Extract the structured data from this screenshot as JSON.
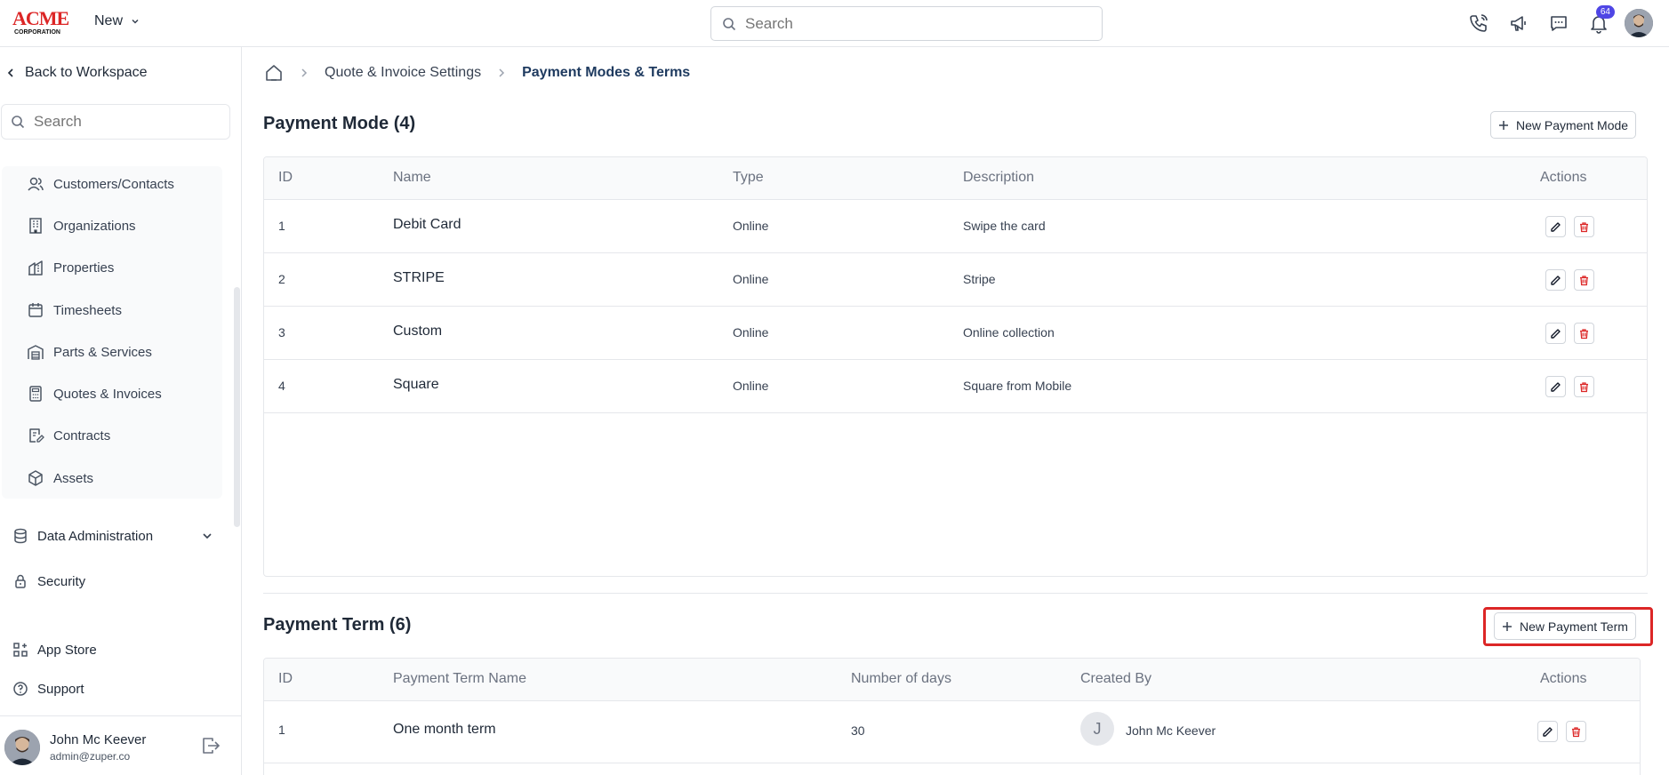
{
  "brand": {
    "name": "ACME",
    "sub": "CORPORATION"
  },
  "topbar": {
    "new_label": "New",
    "search_placeholder": "Search",
    "notification_count": "64"
  },
  "sidebar": {
    "back_label": "Back to Workspace",
    "search_placeholder": "Search",
    "group_items": [
      {
        "label": "Customers/Contacts",
        "icon": "users-icon"
      },
      {
        "label": "Organizations",
        "icon": "building-icon"
      },
      {
        "label": "Properties",
        "icon": "property-icon"
      },
      {
        "label": "Timesheets",
        "icon": "calendar-icon"
      },
      {
        "label": "Parts & Services",
        "icon": "warehouse-icon"
      },
      {
        "label": "Quotes & Invoices",
        "icon": "calculator-icon"
      },
      {
        "label": "Contracts",
        "icon": "contract-icon"
      },
      {
        "label": "Assets",
        "icon": "box-icon"
      }
    ],
    "data_admin_label": "Data Administration",
    "security_label": "Security",
    "app_store_label": "App Store",
    "support_label": "Support",
    "user": {
      "name": "John Mc Keever",
      "email": "admin@zuper.co"
    }
  },
  "breadcrumb": {
    "parent": "Quote & Invoice Settings",
    "current": "Payment Modes & Terms"
  },
  "payment_mode": {
    "title": "Payment Mode (4)",
    "new_button": "New Payment Mode",
    "columns": {
      "id": "ID",
      "name": "Name",
      "type": "Type",
      "description": "Description",
      "actions": "Actions"
    },
    "rows": [
      {
        "id": "1",
        "name": "Debit Card",
        "type": "Online",
        "description": "Swipe the card"
      },
      {
        "id": "2",
        "name": "STRIPE",
        "type": "Online",
        "description": "Stripe"
      },
      {
        "id": "3",
        "name": "Custom",
        "type": "Online",
        "description": "Online collection"
      },
      {
        "id": "4",
        "name": "Square",
        "type": "Online",
        "description": "Square from Mobile"
      }
    ]
  },
  "payment_term": {
    "title": "Payment Term (6)",
    "new_button": "New Payment Term",
    "columns": {
      "id": "ID",
      "name": "Payment Term Name",
      "days": "Number of days",
      "created_by": "Created By",
      "actions": "Actions"
    },
    "rows": [
      {
        "id": "1",
        "name": "One month term",
        "days": "30",
        "created_by": "John Mc Keever",
        "initial": "J"
      }
    ]
  },
  "colors": {
    "accent": "#4f46e5",
    "highlight": "#dc2626",
    "delete": "#dc2626",
    "breadcrumb_current": "#1e3a5f"
  }
}
